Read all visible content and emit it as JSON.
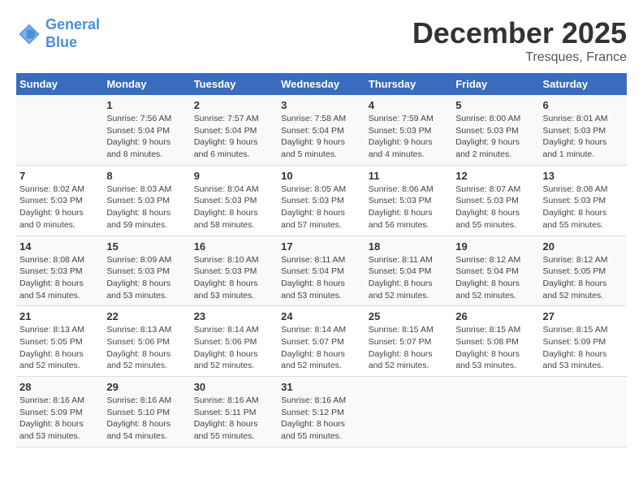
{
  "header": {
    "logo_line1": "General",
    "logo_line2": "Blue",
    "month": "December 2025",
    "location": "Tresques, France"
  },
  "days_of_week": [
    "Sunday",
    "Monday",
    "Tuesday",
    "Wednesday",
    "Thursday",
    "Friday",
    "Saturday"
  ],
  "weeks": [
    [
      {
        "day": "",
        "info": ""
      },
      {
        "day": "1",
        "info": "Sunrise: 7:56 AM\nSunset: 5:04 PM\nDaylight: 9 hours\nand 8 minutes."
      },
      {
        "day": "2",
        "info": "Sunrise: 7:57 AM\nSunset: 5:04 PM\nDaylight: 9 hours\nand 6 minutes."
      },
      {
        "day": "3",
        "info": "Sunrise: 7:58 AM\nSunset: 5:04 PM\nDaylight: 9 hours\nand 5 minutes."
      },
      {
        "day": "4",
        "info": "Sunrise: 7:59 AM\nSunset: 5:03 PM\nDaylight: 9 hours\nand 4 minutes."
      },
      {
        "day": "5",
        "info": "Sunrise: 8:00 AM\nSunset: 5:03 PM\nDaylight: 9 hours\nand 2 minutes."
      },
      {
        "day": "6",
        "info": "Sunrise: 8:01 AM\nSunset: 5:03 PM\nDaylight: 9 hours\nand 1 minute."
      }
    ],
    [
      {
        "day": "7",
        "info": "Sunrise: 8:02 AM\nSunset: 5:03 PM\nDaylight: 9 hours\nand 0 minutes."
      },
      {
        "day": "8",
        "info": "Sunrise: 8:03 AM\nSunset: 5:03 PM\nDaylight: 8 hours\nand 59 minutes."
      },
      {
        "day": "9",
        "info": "Sunrise: 8:04 AM\nSunset: 5:03 PM\nDaylight: 8 hours\nand 58 minutes."
      },
      {
        "day": "10",
        "info": "Sunrise: 8:05 AM\nSunset: 5:03 PM\nDaylight: 8 hours\nand 57 minutes."
      },
      {
        "day": "11",
        "info": "Sunrise: 8:06 AM\nSunset: 5:03 PM\nDaylight: 8 hours\nand 56 minutes."
      },
      {
        "day": "12",
        "info": "Sunrise: 8:07 AM\nSunset: 5:03 PM\nDaylight: 8 hours\nand 55 minutes."
      },
      {
        "day": "13",
        "info": "Sunrise: 8:08 AM\nSunset: 5:03 PM\nDaylight: 8 hours\nand 55 minutes."
      }
    ],
    [
      {
        "day": "14",
        "info": "Sunrise: 8:08 AM\nSunset: 5:03 PM\nDaylight: 8 hours\nand 54 minutes."
      },
      {
        "day": "15",
        "info": "Sunrise: 8:09 AM\nSunset: 5:03 PM\nDaylight: 8 hours\nand 53 minutes."
      },
      {
        "day": "16",
        "info": "Sunrise: 8:10 AM\nSunset: 5:03 PM\nDaylight: 8 hours\nand 53 minutes."
      },
      {
        "day": "17",
        "info": "Sunrise: 8:11 AM\nSunset: 5:04 PM\nDaylight: 8 hours\nand 53 minutes."
      },
      {
        "day": "18",
        "info": "Sunrise: 8:11 AM\nSunset: 5:04 PM\nDaylight: 8 hours\nand 52 minutes."
      },
      {
        "day": "19",
        "info": "Sunrise: 8:12 AM\nSunset: 5:04 PM\nDaylight: 8 hours\nand 52 minutes."
      },
      {
        "day": "20",
        "info": "Sunrise: 8:12 AM\nSunset: 5:05 PM\nDaylight: 8 hours\nand 52 minutes."
      }
    ],
    [
      {
        "day": "21",
        "info": "Sunrise: 8:13 AM\nSunset: 5:05 PM\nDaylight: 8 hours\nand 52 minutes."
      },
      {
        "day": "22",
        "info": "Sunrise: 8:13 AM\nSunset: 5:06 PM\nDaylight: 8 hours\nand 52 minutes."
      },
      {
        "day": "23",
        "info": "Sunrise: 8:14 AM\nSunset: 5:06 PM\nDaylight: 8 hours\nand 52 minutes."
      },
      {
        "day": "24",
        "info": "Sunrise: 8:14 AM\nSunset: 5:07 PM\nDaylight: 8 hours\nand 52 minutes."
      },
      {
        "day": "25",
        "info": "Sunrise: 8:15 AM\nSunset: 5:07 PM\nDaylight: 8 hours\nand 52 minutes."
      },
      {
        "day": "26",
        "info": "Sunrise: 8:15 AM\nSunset: 5:08 PM\nDaylight: 8 hours\nand 53 minutes."
      },
      {
        "day": "27",
        "info": "Sunrise: 8:15 AM\nSunset: 5:09 PM\nDaylight: 8 hours\nand 53 minutes."
      }
    ],
    [
      {
        "day": "28",
        "info": "Sunrise: 8:16 AM\nSunset: 5:09 PM\nDaylight: 8 hours\nand 53 minutes."
      },
      {
        "day": "29",
        "info": "Sunrise: 8:16 AM\nSunset: 5:10 PM\nDaylight: 8 hours\nand 54 minutes."
      },
      {
        "day": "30",
        "info": "Sunrise: 8:16 AM\nSunset: 5:11 PM\nDaylight: 8 hours\nand 55 minutes."
      },
      {
        "day": "31",
        "info": "Sunrise: 8:16 AM\nSunset: 5:12 PM\nDaylight: 8 hours\nand 55 minutes."
      },
      {
        "day": "",
        "info": ""
      },
      {
        "day": "",
        "info": ""
      },
      {
        "day": "",
        "info": ""
      }
    ]
  ]
}
